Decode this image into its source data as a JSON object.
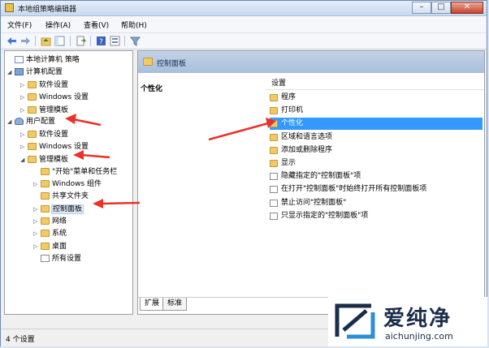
{
  "window": {
    "title": "本地组策略编辑器",
    "buttons": {
      "minimize": "–",
      "maximize": "□",
      "close": "✕"
    }
  },
  "menu": [
    "文件(F)",
    "操作(A)",
    "查看(V)",
    "帮助(H)"
  ],
  "tree": [
    {
      "label": "本地计算机 策略",
      "icon": "policy-icon",
      "expander": ""
    },
    {
      "label": "计算机配置",
      "icon": "computer-icon",
      "expander": "◢"
    },
    {
      "label": "软件设置",
      "icon": "folder-icon",
      "expander": "▷"
    },
    {
      "label": "Windows 设置",
      "icon": "folder-icon",
      "expander": "▷"
    },
    {
      "label": "管理模板",
      "icon": "folder-icon",
      "expander": "▷"
    },
    {
      "label": "用户配置",
      "icon": "user-icon",
      "expander": "◢"
    },
    {
      "label": "软件设置",
      "icon": "folder-icon",
      "expander": "▷"
    },
    {
      "label": "Windows 设置",
      "icon": "folder-icon",
      "expander": "▷"
    },
    {
      "label": "管理模板",
      "icon": "folder-icon",
      "expander": "◢"
    },
    {
      "label": "\"开始\"菜单和任务栏",
      "icon": "folder-icon",
      "expander": ""
    },
    {
      "label": "Windows 组件",
      "icon": "folder-icon",
      "expander": "▷"
    },
    {
      "label": "共享文件夹",
      "icon": "folder-icon",
      "expander": ""
    },
    {
      "label": "控制面板",
      "icon": "folder-icon",
      "expander": "▷"
    },
    {
      "label": "网络",
      "icon": "folder-icon",
      "expander": "▷"
    },
    {
      "label": "系统",
      "icon": "folder-icon",
      "expander": "▷"
    },
    {
      "label": "桌面",
      "icon": "folder-icon",
      "expander": "▷"
    },
    {
      "label": "所有设置",
      "icon": "document-icon",
      "expander": ""
    }
  ],
  "right_panel": {
    "header": "控制面板",
    "description_title": "个性化",
    "settings_header": "设置",
    "items": [
      {
        "label": "程序",
        "icon": "folder-icon"
      },
      {
        "label": "打印机",
        "icon": "folder-icon"
      },
      {
        "label": "个性化",
        "icon": "folder-icon"
      },
      {
        "label": "区域和语言选项",
        "icon": "folder-icon"
      },
      {
        "label": "添加或删除程序",
        "icon": "folder-icon"
      },
      {
        "label": "显示",
        "icon": "folder-icon"
      },
      {
        "label": "隐藏指定的\"控制面板\"项",
        "icon": "policy-setting-icon"
      },
      {
        "label": "在打开\"控制面板\"时始终打开所有控制面板项",
        "icon": "policy-setting-icon"
      },
      {
        "label": "禁止访问\"控制面板\"",
        "icon": "policy-setting-icon"
      },
      {
        "label": "只显示指定的\"控制面板\"项",
        "icon": "policy-setting-icon"
      }
    ],
    "tabs": [
      "扩展",
      "标准"
    ]
  },
  "status": "4 个设置",
  "watermark": {
    "brand": "爱纯净",
    "url": "aichunjing.com"
  },
  "colors": {
    "selection": "#3399ff",
    "annotation_arrow": "#e8322a",
    "header": "#b6c8e0"
  }
}
